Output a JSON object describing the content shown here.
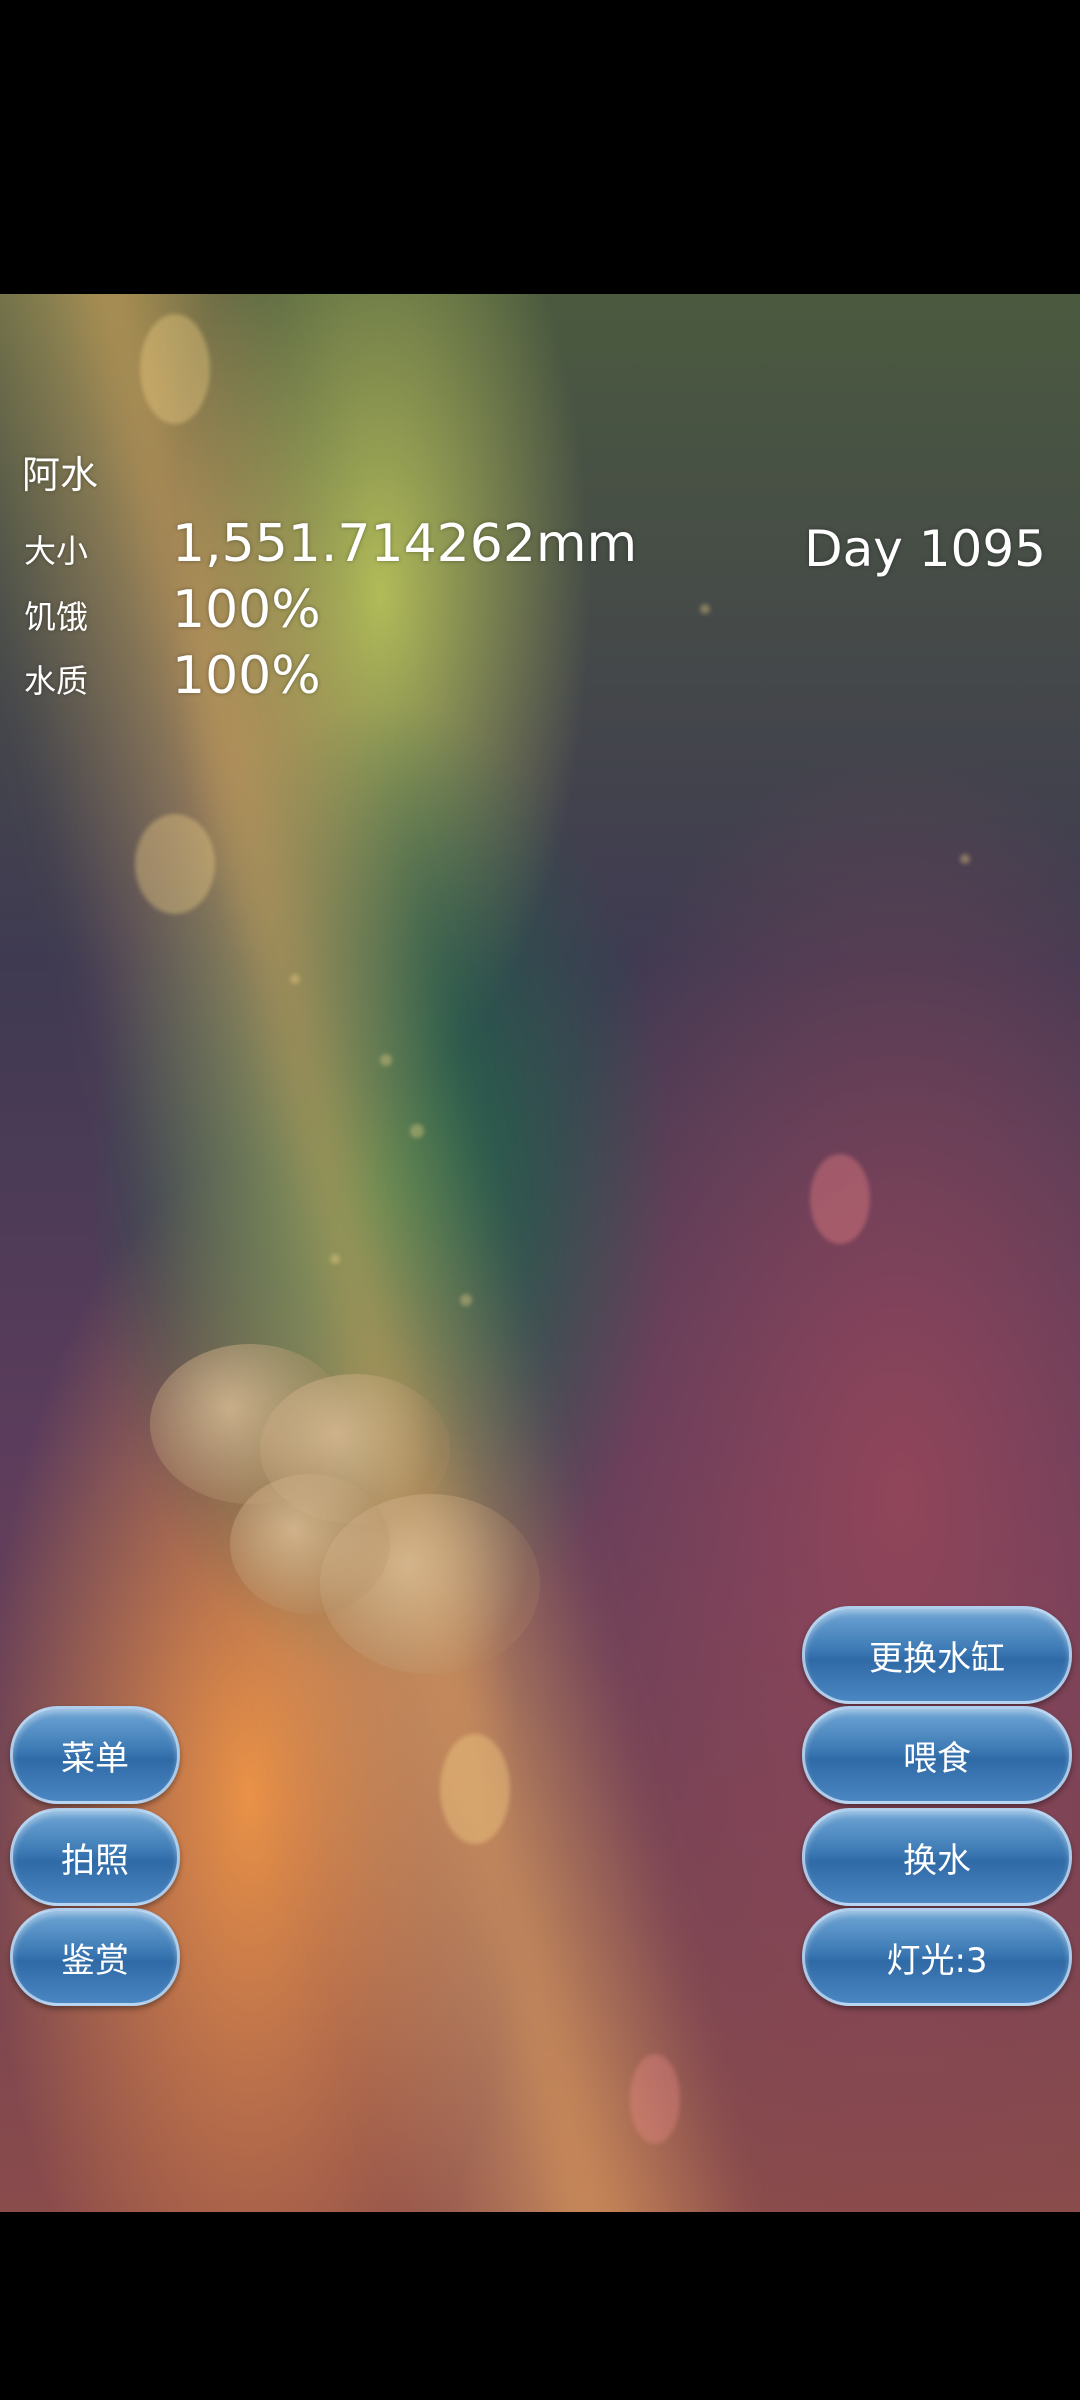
{
  "pet": {
    "name": "阿水",
    "size_label": "大小",
    "size_value": "1,551.714262mm",
    "hunger_label": "饥饿",
    "hunger_value": "100%",
    "water_label": "水质",
    "water_value": "100%",
    "day_label": "Day 1095"
  },
  "left_buttons": {
    "menu": "菜单",
    "photo": "拍照",
    "appreciate": "鉴赏"
  },
  "right_buttons": {
    "change_tank": "更换水缸",
    "feed": "喂食",
    "change_water": "换水",
    "light": "灯光:3"
  },
  "colors": {
    "button_accent": "#3c79b4",
    "text": "#ffffff"
  }
}
